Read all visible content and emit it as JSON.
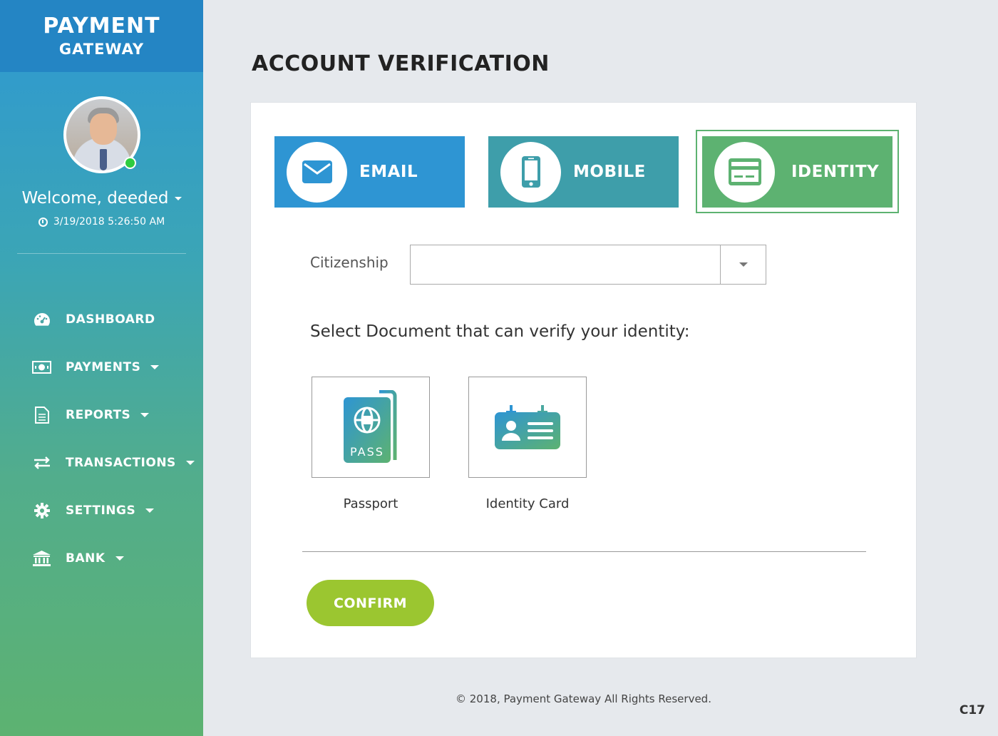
{
  "brand": {
    "line1": "PAYMENT",
    "line2": "GATEWAY"
  },
  "user": {
    "welcome": "Welcome, deeded",
    "datetime": "3/19/2018 5:26:50 AM",
    "status_color": "#2ecc40"
  },
  "nav": [
    {
      "label": "DASHBOARD",
      "icon": "dashboard-icon",
      "has_caret": false
    },
    {
      "label": "PAYMENTS",
      "icon": "money-icon",
      "has_caret": true
    },
    {
      "label": "REPORTS",
      "icon": "document-icon",
      "has_caret": true
    },
    {
      "label": "TRANSACTIONS",
      "icon": "exchange-icon",
      "has_caret": true
    },
    {
      "label": "SETTINGS",
      "icon": "gear-icon",
      "has_caret": true
    },
    {
      "label": "BANK",
      "icon": "bank-icon",
      "has_caret": true
    }
  ],
  "page": {
    "title": "ACCOUNT VERIFICATION"
  },
  "tabs": [
    {
      "label": "EMAIL",
      "icon": "envelope-icon",
      "color": "#2e95d3"
    },
    {
      "label": "MOBILE",
      "icon": "mobile-phone-icon",
      "color": "#3e9eaa"
    },
    {
      "label": "IDENTITY",
      "icon": "id-card-icon",
      "color": "#5db271",
      "active": true
    }
  ],
  "form": {
    "citizenship_label": "Citizenship",
    "citizenship_value": "",
    "doc_prompt": "Select Document that can verify your identity:",
    "documents": [
      {
        "label": "Passport",
        "icon": "passport-icon"
      },
      {
        "label": "Identity Card",
        "icon": "identity-card-icon"
      }
    ],
    "confirm_label": "CONFIRM",
    "confirm_color": "#9bc630"
  },
  "footer": {
    "text": "© 2018, Payment Gateway All Rights Reserved."
  },
  "corner_code": "C17"
}
